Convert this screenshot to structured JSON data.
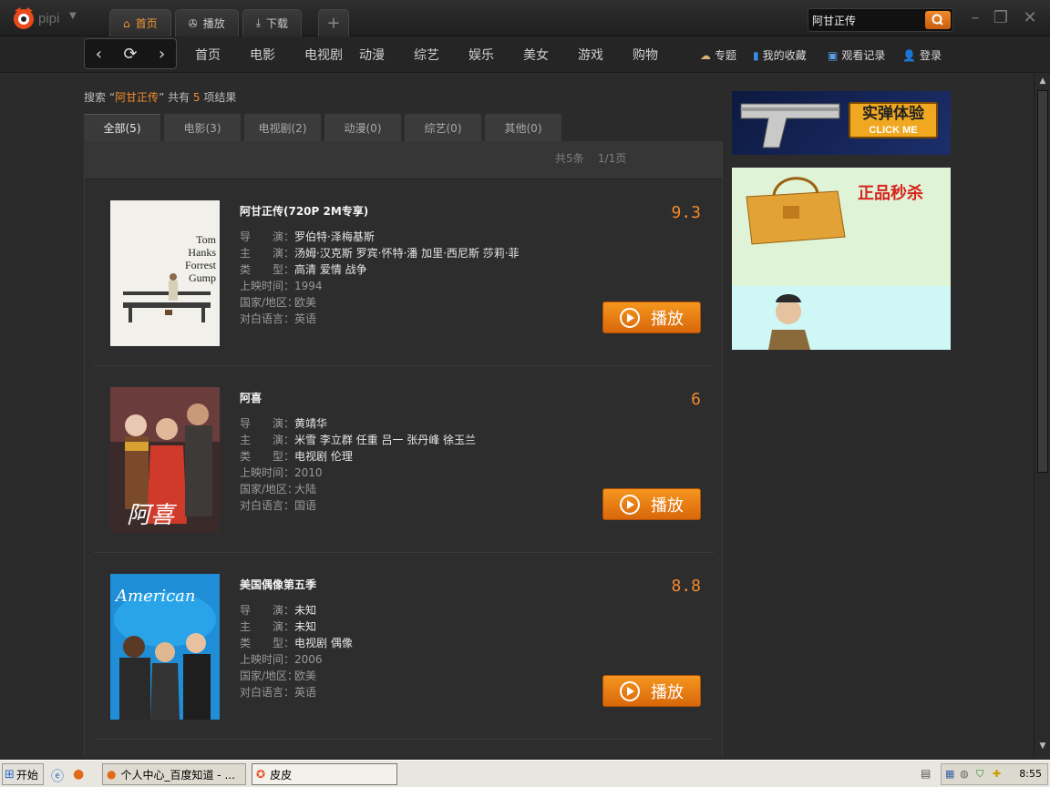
{
  "app": {
    "logo_text": "pipi"
  },
  "top_tabs": [
    {
      "label": "首页",
      "icon": "home-icon",
      "active": true
    },
    {
      "label": "播放",
      "icon": "film-reel-icon",
      "active": false
    },
    {
      "label": "下载",
      "icon": "download-icon",
      "active": false
    }
  ],
  "search": {
    "value": "阿甘正传"
  },
  "nav_menu": [
    "首页",
    "电影",
    "电视剧",
    "动漫",
    "综艺",
    "娱乐",
    "美女",
    "游戏",
    "购物"
  ],
  "quick_links": [
    {
      "label": "专题",
      "icon": "topic-icon"
    },
    {
      "label": "我的收藏",
      "icon": "bookmark-icon"
    },
    {
      "label": "观看记录",
      "icon": "history-icon"
    },
    {
      "label": "登录",
      "icon": "user-icon"
    }
  ],
  "result_info": {
    "prefix": "搜索 “",
    "keyword": "阿甘正传",
    "mid": "” 共有 ",
    "count": "5",
    "suffix": " 项结果"
  },
  "filter_tabs": [
    "全部(5)",
    "电影(3)",
    "电视剧(2)",
    "动漫(0)",
    "综艺(0)",
    "其他(0)"
  ],
  "pager": {
    "total": "共5条",
    "pages": "1/1页"
  },
  "meta_labels": {
    "director": "导　　演：",
    "cast": "主　　演：",
    "genre": "类　　型：",
    "year": "上映时间：",
    "region": "国家/地区：",
    "language": "对白语言："
  },
  "play_label": "播放",
  "results": [
    {
      "title": "阿甘正传(720P 2M专享)",
      "score": "9.3",
      "director": "罗伯特·泽梅基斯",
      "cast": "汤姆·汉克斯 罗宾·怀特·潘 加里·西尼斯 莎莉·菲",
      "genre": "高清 爱情 战争",
      "year": "1994",
      "region": "欧美",
      "language": "英语",
      "poster_text": [
        "Tom",
        "Hanks",
        "Forrest",
        "Gump"
      ]
    },
    {
      "title": "阿喜",
      "score": "6",
      "director": "黄靖华",
      "cast": "米雪 李立群 任重 吕一 张丹峰 徐玉兰",
      "genre": "电视剧 伦理",
      "year": "2010",
      "region": "大陆",
      "language": "国语",
      "poster_text": [
        "阿喜"
      ]
    },
    {
      "title": "美国偶像第五季",
      "score": "8.8",
      "director": "未知",
      "cast": "未知",
      "genre": "电视剧 偶像",
      "year": "2006",
      "region": "欧美",
      "language": "英语",
      "poster_text": [
        "American"
      ]
    }
  ],
  "ads": [
    {
      "text": "实弹体验",
      "sub": "CLICK ME"
    },
    {
      "text": "正品秒杀"
    }
  ],
  "taskbar": {
    "start": "开始",
    "tasks": [
      {
        "label": "个人中心_百度知道 - ...",
        "active": false
      },
      {
        "label": "皮皮",
        "active": true
      }
    ],
    "clock": "8:55"
  },
  "colors": {
    "accent": "#f28a2c",
    "bg": "#2b2b2b",
    "play_button": "#e8780f"
  }
}
